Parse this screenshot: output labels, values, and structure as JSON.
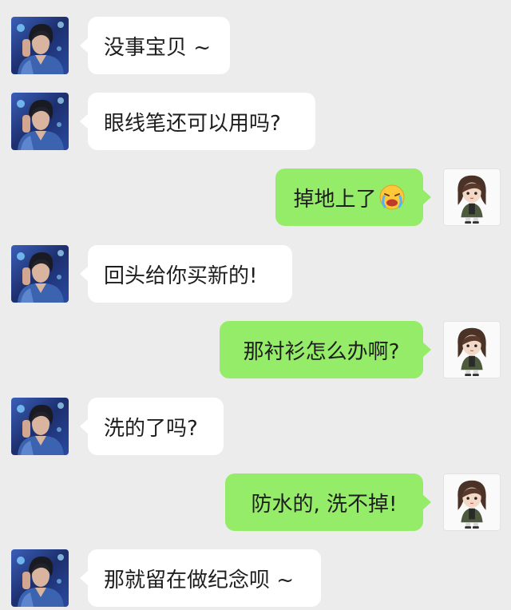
{
  "colors": {
    "background": "#ececec",
    "incoming_bubble": "#ffffff",
    "outgoing_bubble": "#95ec69",
    "text": "#1e1e1e"
  },
  "messages": [
    {
      "side": "incoming",
      "text": "没事宝贝 ~",
      "avatar": "male-photo-avatar"
    },
    {
      "side": "incoming",
      "text": "眼线笔还可以用吗?",
      "avatar": "male-photo-avatar"
    },
    {
      "side": "outgoing",
      "text": "掉地上了",
      "emoji": "crying-face-emoji",
      "avatar": "cartoon-girl-avatar"
    },
    {
      "side": "incoming",
      "text": "回头给你买新的!",
      "avatar": "male-photo-avatar"
    },
    {
      "side": "outgoing",
      "text": "那衬衫怎么办啊?",
      "avatar": "cartoon-girl-avatar"
    },
    {
      "side": "incoming",
      "text": "洗的了吗?",
      "avatar": "male-photo-avatar"
    },
    {
      "side": "outgoing",
      "text": "防水的, 洗不掉!",
      "avatar": "cartoon-girl-avatar"
    },
    {
      "side": "incoming",
      "text": "那就留在做纪念呗 ~",
      "avatar": "male-photo-avatar"
    }
  ]
}
